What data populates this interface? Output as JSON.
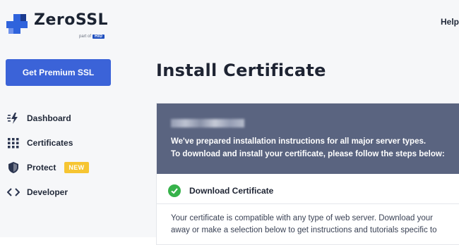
{
  "brand": {
    "name": "ZeroSSL",
    "part_of": "part of",
    "parent": "HID"
  },
  "sidebar": {
    "premium_button": "Get Premium SSL",
    "items": [
      {
        "label": "Dashboard",
        "icon": "lightning-icon"
      },
      {
        "label": "Certificates",
        "icon": "grid-icon"
      },
      {
        "label": "Protect",
        "icon": "shield-icon",
        "badge": "NEW"
      },
      {
        "label": "Developer",
        "icon": "code-icon"
      }
    ]
  },
  "header": {
    "help": "Help"
  },
  "main": {
    "title": "Install Certificate",
    "card": {
      "intro_line1": "We've prepared installation instructions for all major server types.",
      "intro_line2": "To download and install your certificate, please follow the steps below:",
      "step_label": "Download Certificate",
      "body_line1": "Your certificate is compatible with any type of web server. Download your",
      "body_line2": "away or make a selection below to get instructions and tutorials specific to"
    }
  },
  "colors": {
    "accent": "#3b63d8",
    "card_header": "#5a6480",
    "success": "#36b24a",
    "badge": "#f6c532"
  }
}
